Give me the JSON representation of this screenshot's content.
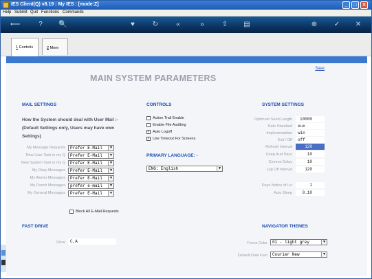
{
  "window": {
    "title": "IES Client(Q) v8.19 : My IES :      [mode:Z]",
    "minimize": "_",
    "maximize": "□",
    "close": "✕"
  },
  "menu": [
    "Help",
    "Submit",
    "Quit",
    "Functions",
    "Commands"
  ],
  "toolbar": {
    "icons": [
      "back-arrow-icon",
      "help-icon",
      "search-icon",
      "heart-icon",
      "refresh-icon",
      "rewind-icon",
      "forward-icon",
      "upload-icon",
      "document-icon",
      "globe-icon",
      "checkmark-icon",
      "close-icon"
    ],
    "glyphs": [
      "⟵",
      "?",
      "🔍",
      "♥",
      "↻",
      "«",
      "»",
      "⇧",
      "▤",
      "⊕",
      "✓",
      "✕"
    ]
  },
  "tabs": [
    {
      "num": "1",
      "label": "Controls"
    },
    {
      "num": "2",
      "label": "More"
    }
  ],
  "page": {
    "save_label": "Save",
    "heading": "MAIN SYSTEM PARAMETERS"
  },
  "mail": {
    "section_title": "MAIL SETTINGS",
    "description": "How the System should deal with User Mail :- (Default Settings only, Users may have own Settings)",
    "rows": [
      {
        "label": "My Message Requests",
        "value": "Prefer E-Mail"
      },
      {
        "label": "New User Task in my Q",
        "value": "Prefer E-Mail"
      },
      {
        "label": "New System Task in my Q",
        "value": "Prefer E-Mail"
      },
      {
        "label": "My Diary Messages",
        "value": "Prefer E-Mail"
      },
      {
        "label": "My Alerter Messages",
        "value": "Prefer E-Mail"
      },
      {
        "label": "My Punch Messages",
        "value": "prefer e-mail"
      },
      {
        "label": "My General Messages",
        "value": "Prefer E-Mail"
      }
    ],
    "block_label": "Block All E-Mail Requests",
    "block_checked": false
  },
  "controls": {
    "section_title": "CONTROLS",
    "items": [
      {
        "label": "Action Trail Enable",
        "checked": false
      },
      {
        "label": "Enable File Auditing",
        "checked": false
      },
      {
        "label": "Auto Logoff",
        "checked": true
      },
      {
        "label": "Use Timeout For Screens",
        "checked": true
      }
    ],
    "language_title": "PRIMARY LANGUAGE: -",
    "language_value": "ENG: English"
  },
  "system": {
    "section_title": "SYSTEM SETTINGS",
    "rows": [
      {
        "label": "Optimum Send Length",
        "value": "10000"
      },
      {
        "label": "Date Standard",
        "value": "eux"
      },
      {
        "label": "Implementation",
        "value": "win"
      },
      {
        "label": "Exit / Off",
        "value": "off"
      },
      {
        "label": "Refresh Interval",
        "value": "120"
      },
      {
        "label": "Keep Aud Days",
        "value": "10"
      },
      {
        "label": "Comms Delay",
        "value": "10"
      },
      {
        "label": "Log Off Interval",
        "value": "120"
      }
    ],
    "notice_label": "Days Notice of Lic",
    "notice_value": "1",
    "auto_sleep_label": "Auto Sleep",
    "auto_sleep_value": "0.10"
  },
  "fast_drive": {
    "section_title": "FAST DRIVE",
    "drive_label": "Drive",
    "drive_value": "C,A"
  },
  "navigator": {
    "section_title": "NAVIGATOR THEMES",
    "color_label": "Focus Color",
    "color_value": "01 - light grey",
    "font_label": "Default Data Font",
    "font_value": "Courier New"
  }
}
